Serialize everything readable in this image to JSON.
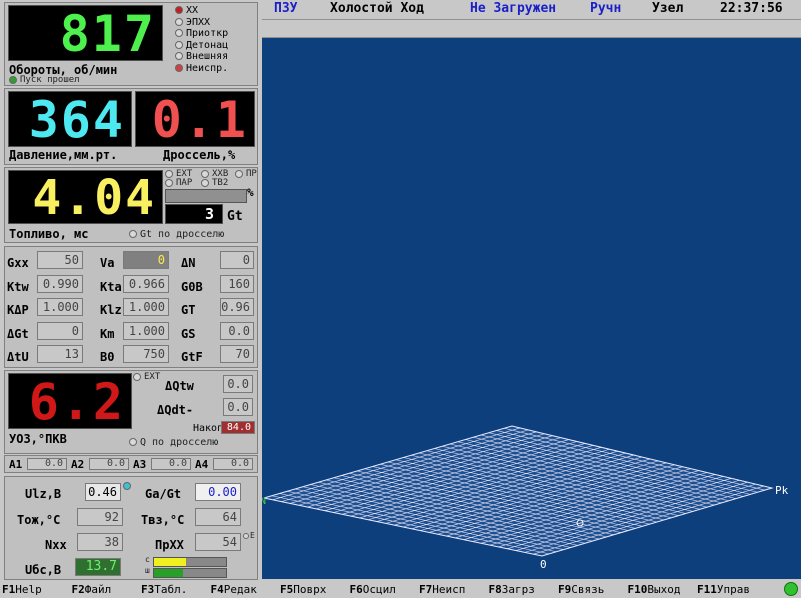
{
  "rpm": {
    "value": "817",
    "label": "Обороты, об/мин",
    "status": "Пуск прошел"
  },
  "indicators": [
    {
      "label": "ХХ",
      "state": "red"
    },
    {
      "label": "ЭПХХ",
      "state": "off"
    },
    {
      "label": "Приоткр",
      "state": "off"
    },
    {
      "label": "Детонац",
      "state": "off"
    },
    {
      "label": "Внешняя",
      "state": "off"
    },
    {
      "label": "Неиспр.",
      "state": "red"
    }
  ],
  "pressure": {
    "value": "364",
    "label": "Давление,мм.рт."
  },
  "throttle": {
    "value": "0.1",
    "label": "Дроссель,%"
  },
  "fuel": {
    "value": "4.04",
    "label": "Топливо, мс",
    "opts": [
      "EXT",
      "ХХВ",
      "ПР",
      "ПАР",
      "ТВ2"
    ],
    "percent_sign": "%",
    "gt_value": "3",
    "gt_label": "Gt",
    "gt_throttle": "Gt по дросселю"
  },
  "params": [
    {
      "l1": "Gxx",
      "v1": "50",
      "l2": "Va",
      "v2": "0",
      "l3": "ΔN",
      "v3": "0"
    },
    {
      "l1": "Ktw",
      "v1": "0.990",
      "l2": "Kta",
      "v2": "0.966",
      "l3": "G0B",
      "v3": "160"
    },
    {
      "l1": "KΔP",
      "v1": "1.000",
      "l2": "Klz",
      "v2": "1.000",
      "l3": "GT",
      "v3": "0.96"
    },
    {
      "l1": "ΔGt",
      "v1": "0",
      "l2": "Km",
      "v2": "1.000",
      "l3": "GS",
      "v3": "0.0"
    },
    {
      "l1": "ΔtU",
      "v1": "13",
      "l2": "B0",
      "v2": "750",
      "l3": "GtF",
      "v3": "70"
    }
  ],
  "uoz": {
    "value": "6.2",
    "label": "УОЗ,°ПКВ",
    "ext": "EXT",
    "dqtw_label": "ΔQtw",
    "dqtw": "0.0",
    "dqdt_label": "ΔQdt-",
    "dqdt": "0.0",
    "nakop_label": "Накоп",
    "nakop": "84.0",
    "q_throttle": "Q по дросселю"
  },
  "analog": [
    {
      "label": "A1",
      "value": "0.0"
    },
    {
      "label": "A2",
      "value": "0.0"
    },
    {
      "label": "A3",
      "value": "0.0"
    },
    {
      "label": "A4",
      "value": "0.0"
    }
  ],
  "bottom": {
    "ulz_label": "Ulz,B",
    "ulz": "0.46",
    "gagt_label": "Ga/Gt",
    "gagt": "0.00",
    "tozh_label": "Тож,°C",
    "tozh": "92",
    "tvz_label": "Твз,°C",
    "tvz": "64",
    "nxx_label": "Nxx",
    "nxx": "38",
    "prxx_label": "ПрХХ",
    "prxx": "54",
    "e_label": "E",
    "ubs_label": "Uбс,B",
    "ubs": "13.7",
    "bar_c": "c",
    "bar_sh": "ш"
  },
  "topbar": {
    "pzu": "ПЗУ",
    "mode": "Холостой Ход",
    "load": "Не Загружен",
    "manual": "Ручн",
    "node": "Узел",
    "time": "22:37:56"
  },
  "plot": {
    "axis_right": "Pk",
    "axis_bottom": "0",
    "axis_left": "N"
  },
  "fkeys": [
    {
      "k": "F1",
      "t": "Help"
    },
    {
      "k": "F2",
      "t": "Файл"
    },
    {
      "k": "F3",
      "t": "Табл."
    },
    {
      "k": "F4",
      "t": "Редак"
    },
    {
      "k": "F5",
      "t": "Поврх"
    },
    {
      "k": "F6",
      "t": "Осцил"
    },
    {
      "k": "F7",
      "t": "Неисп"
    },
    {
      "k": "F8",
      "t": "Загрз"
    },
    {
      "k": "F9",
      "t": "Связь"
    },
    {
      "k": "F10",
      "t": "Выход"
    },
    {
      "k": "F11",
      "t": "Управ"
    }
  ],
  "colors": {
    "rpm": "#4ef04e",
    "pressure": "#4ee8f0",
    "throttle": "#f05050",
    "fuel": "#f8f060",
    "uoz": "#d01818",
    "plot_bg": "#0e3f7d",
    "grid": "#e8e8ff"
  }
}
